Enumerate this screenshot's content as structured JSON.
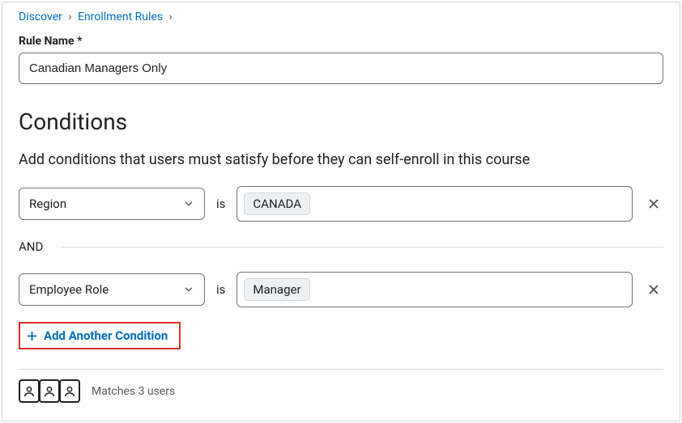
{
  "breadcrumb": {
    "items": [
      "Discover",
      "Enrollment Rules"
    ]
  },
  "ruleName": {
    "label": "Rule Name *",
    "value": "Canadian Managers Only"
  },
  "conditionsHeading": "Conditions",
  "helpText": "Add conditions that users must satisfy before they can self-enroll in this course",
  "isText": "is",
  "andText": "AND",
  "conditions": [
    {
      "attribute": "Region",
      "value": "CANADA"
    },
    {
      "attribute": "Employee Role",
      "value": "Manager"
    }
  ],
  "addCondition": "Add Another Condition",
  "matches": "Matches 3 users"
}
